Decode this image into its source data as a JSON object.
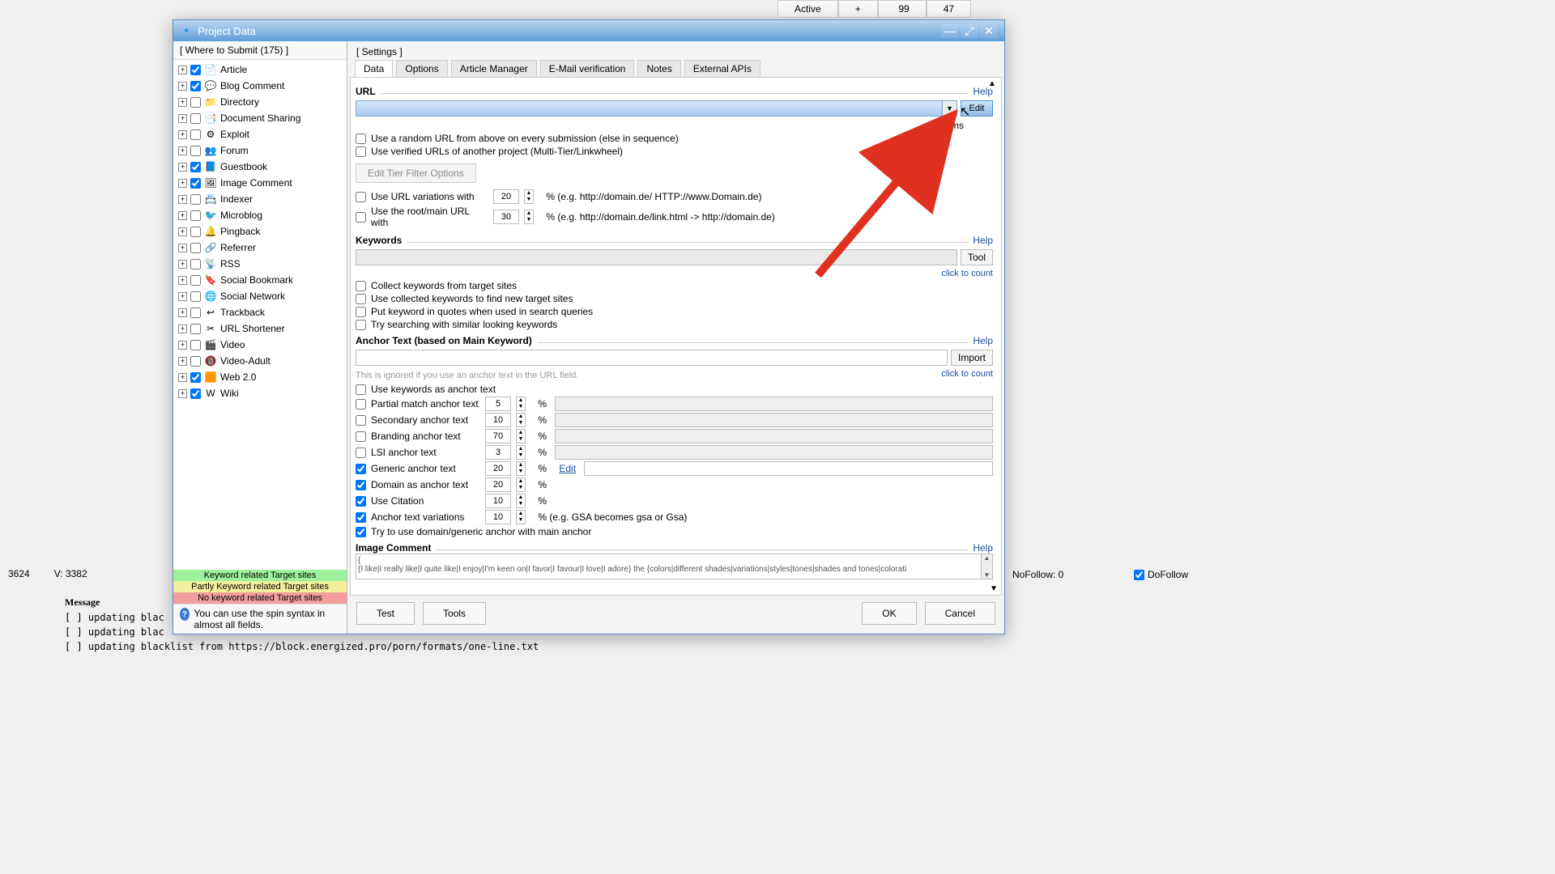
{
  "bg": {
    "tabs": [
      "Active",
      "+"
    ],
    "nums": [
      "99",
      "47"
    ],
    "status_left": "3624",
    "status_v": "V: 3382",
    "msg_header": "Message",
    "log": [
      "[ ] updating blac",
      "[ ] updating blac",
      "[ ] updating blacklist from https://block.energized.pro/porn/formats/one-line.txt"
    ],
    "nofollow": "NoFollow:  0",
    "dofollow": "DoFollow"
  },
  "titlebar": {
    "title": "Project Data"
  },
  "left": {
    "header": "[ Where to Submit  (175) ]",
    "items": [
      {
        "label": "Article",
        "checked": true,
        "icon": "📄"
      },
      {
        "label": "Blog Comment",
        "checked": true,
        "icon": "💬"
      },
      {
        "label": "Directory",
        "checked": false,
        "icon": "📁"
      },
      {
        "label": "Document Sharing",
        "checked": false,
        "icon": "📑"
      },
      {
        "label": "Exploit",
        "checked": false,
        "icon": "⚙"
      },
      {
        "label": "Forum",
        "checked": false,
        "icon": "👥"
      },
      {
        "label": "Guestbook",
        "checked": true,
        "icon": "📘"
      },
      {
        "label": "Image Comment",
        "checked": true,
        "icon": "🖼"
      },
      {
        "label": "Indexer",
        "checked": false,
        "icon": "📇"
      },
      {
        "label": "Microblog",
        "checked": false,
        "icon": "🐦"
      },
      {
        "label": "Pingback",
        "checked": false,
        "icon": "🔔"
      },
      {
        "label": "Referrer",
        "checked": false,
        "icon": "🔗"
      },
      {
        "label": "RSS",
        "checked": false,
        "icon": "📡"
      },
      {
        "label": "Social Bookmark",
        "checked": false,
        "icon": "🔖"
      },
      {
        "label": "Social Network",
        "checked": false,
        "icon": "🌐"
      },
      {
        "label": "Trackback",
        "checked": false,
        "icon": "↩"
      },
      {
        "label": "URL Shortener",
        "checked": false,
        "icon": "✂"
      },
      {
        "label": "Video",
        "checked": false,
        "icon": "🎬"
      },
      {
        "label": "Video-Adult",
        "checked": false,
        "icon": "🔞"
      },
      {
        "label": "Web 2.0",
        "checked": true,
        "icon": "🟧"
      },
      {
        "label": "Wiki",
        "checked": true,
        "icon": "W"
      }
    ],
    "legend": {
      "g": "Keyword related Target sites",
      "y": "Partly Keyword related Target sites",
      "r": "No keyword related Target sites"
    },
    "hint": "You can use the spin syntax in almost all fields."
  },
  "right": {
    "header": "[ Settings ]",
    "tabs": [
      "Data",
      "Options",
      "Article Manager",
      "E-Mail verification",
      "Notes",
      "External APIs"
    ],
    "active_tab": 0,
    "url": {
      "label": "URL",
      "help": "Help",
      "edit": "Edit",
      "items": "8 Items",
      "chk1": "Use a random URL from above on every submission (else in sequence)",
      "chk2": "Use verified URLs of another project (Multi-Tier/Linkwheel)",
      "tierbtn": "Edit Tier Filter Options",
      "chk3": "Use URL variations with",
      "v3": "20",
      "hint3": "%  (e.g. http://domain.de/ HTTP://www.Domain.de)",
      "chk4": "Use the root/main URL with",
      "v4": "30",
      "hint4": "%  (e.g. http://domain.de/link.html -> http://domain.de)"
    },
    "kw": {
      "label": "Keywords",
      "help": "Help",
      "tool": "Tool",
      "count": "click to count",
      "c1": "Collect keywords from target sites",
      "c2": "Use collected keywords to find new target sites",
      "c3": "Put keyword in quotes when used in search queries",
      "c4": "Try searching with similar looking keywords"
    },
    "anchor": {
      "label": "Anchor Text (based on Main Keyword)",
      "help": "Help",
      "import": "Import",
      "count": "click to count",
      "note": "This is ignored if you use an anchor text in the URL field.",
      "r0": "Use keywords as anchor text",
      "rows": [
        {
          "label": "Partial match anchor text",
          "v": "5",
          "checked": false,
          "gray": true
        },
        {
          "label": "Secondary anchor text",
          "v": "10",
          "checked": false,
          "gray": true
        },
        {
          "label": "Branding anchor text",
          "v": "70",
          "checked": false,
          "gray": true
        },
        {
          "label": "LSI anchor text",
          "v": "3",
          "checked": false,
          "gray": true
        },
        {
          "label": "Generic anchor text",
          "v": "20",
          "checked": true,
          "gray": false,
          "extra": "Edit"
        },
        {
          "label": "Domain as anchor text",
          "v": "20",
          "checked": true,
          "gray": false,
          "noinput": true
        },
        {
          "label": "Use Citation",
          "v": "10",
          "checked": true,
          "gray": false,
          "noinput": true
        },
        {
          "label": "Anchor text variations",
          "v": "10",
          "checked": true,
          "gray": false,
          "noinput": true,
          "suffix": "%  (e.g. GSA becomes gsa or Gsa)"
        }
      ],
      "last": "Try to use domain/generic anchor with main anchor"
    },
    "img": {
      "label": "Image Comment",
      "help": "Help",
      "content": "{I like|I really like|I quite like|I enjoy|I'm keen on|I favor|I favour|I love|I adore} the {colors|different shades|variations|styles|tones|shades and tones|colorati"
    },
    "buttons": {
      "test": "Test",
      "tools": "Tools",
      "ok": "OK",
      "cancel": "Cancel"
    }
  }
}
